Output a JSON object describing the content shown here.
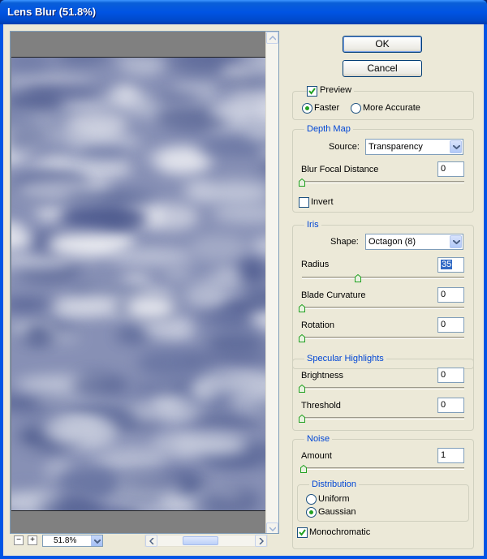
{
  "window": {
    "title": "Lens Blur (51.8%)"
  },
  "zoom": {
    "value": "51.8%",
    "minus": "−",
    "plus": "+"
  },
  "buttons": {
    "ok": "OK",
    "cancel": "Cancel"
  },
  "preview": {
    "label": "Preview",
    "checked": true,
    "faster": "Faster",
    "more_accurate": "More Accurate",
    "selected_mode": "Faster"
  },
  "depth_map": {
    "group_label": "Depth Map",
    "source_label": "Source:",
    "source_value": "Transparency",
    "blur_focal_label": "Blur Focal Distance",
    "blur_focal_value": "0",
    "invert_label": "Invert",
    "invert_checked": false
  },
  "iris": {
    "group_label": "Iris",
    "shape_label": "Shape:",
    "shape_value": "Octagon (8)",
    "radius_label": "Radius",
    "radius_value": "35",
    "blade_label": "Blade Curvature",
    "blade_value": "0",
    "rotation_label": "Rotation",
    "rotation_value": "0"
  },
  "specular": {
    "group_label": "Specular Highlights",
    "brightness_label": "Brightness",
    "brightness_value": "0",
    "threshold_label": "Threshold",
    "threshold_value": "0"
  },
  "noise": {
    "group_label": "Noise",
    "amount_label": "Amount",
    "amount_value": "1",
    "distribution_label": "Distribution",
    "uniform": "Uniform",
    "gaussian": "Gaussian",
    "selected_distribution": "Gaussian",
    "monochromatic_label": "Monochromatic",
    "monochromatic_checked": true
  },
  "colors": {
    "title_bar": "#0054e3",
    "dialog_bg": "#ece9d8",
    "group_label": "#0046d5",
    "preview_tint": "#8790b5"
  }
}
